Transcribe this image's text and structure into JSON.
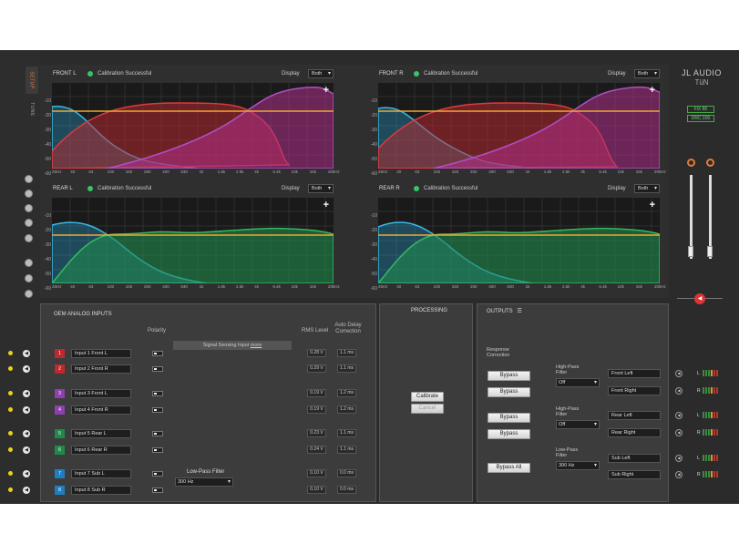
{
  "sidebar": {
    "tabs": [
      {
        "label": "SETUP"
      },
      {
        "label": "TUNE"
      }
    ],
    "icons": [
      "user-icon",
      "download-icon",
      "save-icon",
      "wrench-icon",
      "list-icon",
      "settings-icon",
      "power-icon",
      "help-icon"
    ]
  },
  "graphs": [
    {
      "title": "FRONT L",
      "status": "Calibration Successful",
      "display_label": "Display",
      "display_value": "Both"
    },
    {
      "title": "FRONT R",
      "status": "Calibration Successful",
      "display_label": "Display",
      "display_value": "Both"
    },
    {
      "title": "REAR L",
      "status": "Calibration Successful",
      "display_label": "Display",
      "display_value": "Both"
    },
    {
      "title": "REAR R",
      "status": "Calibration Successful",
      "display_label": "Display",
      "display_value": "Both"
    }
  ],
  "axis": {
    "y": [
      "-10",
      "-20",
      "-30",
      "-40",
      "-50",
      "-60"
    ],
    "x": [
      "25Hz",
      "40",
      "63",
      "100",
      "160",
      "250",
      "400",
      "630",
      "1k",
      "1.6k",
      "2.5k",
      "4k",
      "6.4k",
      "10k",
      "16k",
      "20kHz"
    ]
  },
  "brand": {
    "logo": "JL AUDIO",
    "sub": "TüN",
    "device1": "FiX 86",
    "device2": "DRC 200"
  },
  "inputs": {
    "title": "OEM ANALOG INPUTS",
    "col_polarity": "Polarity",
    "col_rms": "RMS Level",
    "col_delay": "Auto Delay Correction",
    "signal_sensing": "Signal Sensing Input",
    "signal_sensing_link": "more",
    "lpf_label": "Low-Pass Filter",
    "lpf_value": "300 Hz",
    "channels": [
      {
        "num": "1",
        "name": "Input 1 Front L",
        "rms": "0.28 V",
        "delay": "1.1 ms",
        "color": "#c0282d"
      },
      {
        "num": "2",
        "name": "Input 2 Front R",
        "rms": "0.29 V",
        "delay": "1.1 ms",
        "color": "#c0282d"
      },
      {
        "num": "3",
        "name": "Input 3 Front L",
        "rms": "0.19 V",
        "delay": "1.2 ms",
        "color": "#8e3fb0"
      },
      {
        "num": "4",
        "name": "Input 4 Front R",
        "rms": "0.19 V",
        "delay": "1.2 ms",
        "color": "#8e3fb0"
      },
      {
        "num": "5",
        "name": "Input 5 Rear L",
        "rms": "0.23 V",
        "delay": "1.1 ms",
        "color": "#1f8a4c"
      },
      {
        "num": "6",
        "name": "Input 6 Rear R",
        "rms": "0.24 V",
        "delay": "1.1 ms",
        "color": "#1f8a4c"
      },
      {
        "num": "7",
        "name": "Input 7 Sub L",
        "rms": "0.10 V",
        "delay": "0.0 ms",
        "color": "#1e7fc0"
      },
      {
        "num": "8",
        "name": "Input 8 Sub R",
        "rms": "0.10 V",
        "delay": "0.0 ms",
        "color": "#1e7fc0"
      }
    ]
  },
  "processing": {
    "title": "PROCESSING",
    "calibrate": "Calibrate",
    "cancel": "Cancel"
  },
  "outputs": {
    "title": "OUTPUTS",
    "response_correction": "Response Correction",
    "bypass": "Bypass",
    "bypass_all": "Bypass All",
    "hpf_label": "High-Pass Filter",
    "lpf_label": "Low-Pass Filter",
    "hpf1_value": "Off",
    "hpf2_value": "Off",
    "lpf_value": "300 Hz",
    "names": [
      "Front Left",
      "Front Right",
      "Rear Left",
      "Rear Right",
      "Sub Left",
      "Sub Right"
    ],
    "lr": [
      "L",
      "R",
      "L",
      "R",
      "L",
      "R"
    ]
  }
}
